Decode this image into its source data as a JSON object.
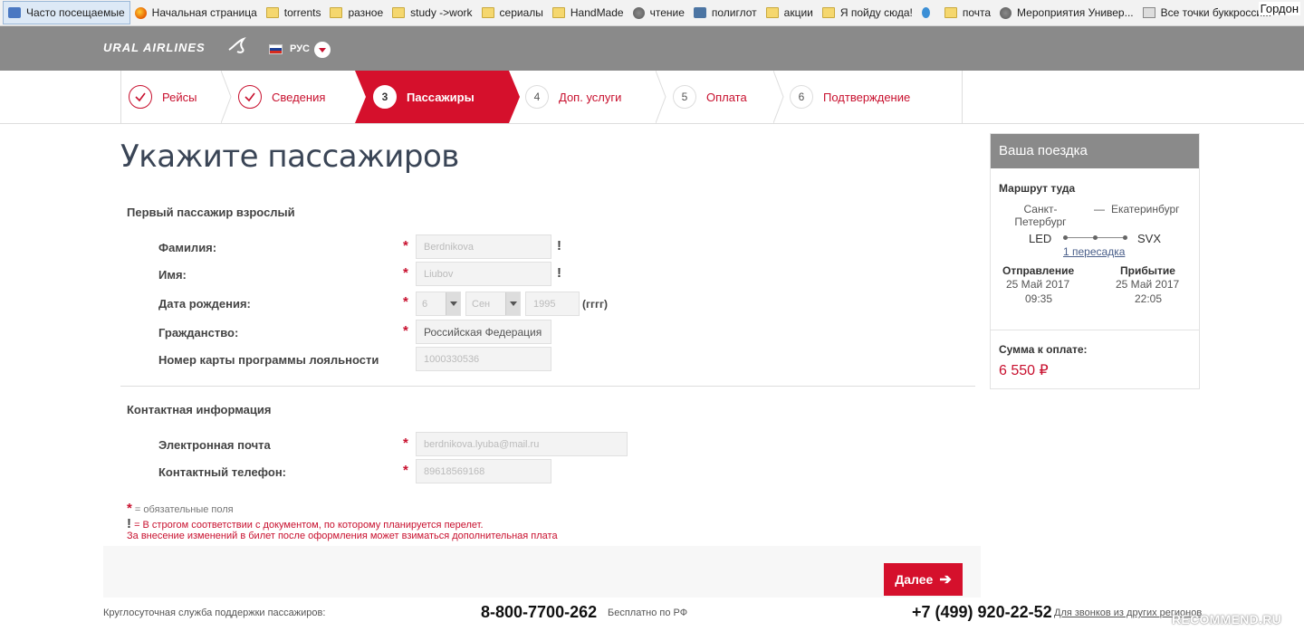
{
  "browser": {
    "bookmarks": [
      {
        "label": "Часто посещаемые",
        "icon": "page-icon"
      },
      {
        "label": "Начальная страница",
        "icon": "firefox-icon"
      },
      {
        "label": "torrents",
        "icon": "folder-icon"
      },
      {
        "label": "разное",
        "icon": "folder-icon"
      },
      {
        "label": "study ->work",
        "icon": "folder-icon"
      },
      {
        "label": "сериалы",
        "icon": "folder-icon"
      },
      {
        "label": "HandMade",
        "icon": "folder-icon"
      },
      {
        "label": "чтение",
        "icon": "globe-icon"
      },
      {
        "label": "полиглот",
        "icon": "vk-icon"
      },
      {
        "label": "акции",
        "icon": "folder-icon"
      },
      {
        "label": "Я пойду сюда!",
        "icon": "folder-icon"
      },
      {
        "label": "почта",
        "icon": "folder-icon"
      },
      {
        "label": "Мероприятия Универ...",
        "icon": "globe-icon"
      },
      {
        "label": "Все точки буккросси...",
        "icon": "image-icon"
      }
    ],
    "corner_text": "Гордон"
  },
  "header": {
    "logo": "URAL AIRLINES",
    "language": "РУС",
    "colors": {
      "brand_red": "#d5102c",
      "header_gray": "#8a8a8a"
    }
  },
  "steps": [
    {
      "number": "1",
      "label": "Рейсы",
      "state": "done"
    },
    {
      "number": "2",
      "label": "Сведения",
      "state": "done"
    },
    {
      "number": "3",
      "label": "Пассажиры",
      "state": "active"
    },
    {
      "number": "4",
      "label": "Доп. услуги",
      "state": "pending"
    },
    {
      "number": "5",
      "label": "Оплата",
      "state": "pending"
    },
    {
      "number": "6",
      "label": "Подтверждение",
      "state": "pending"
    }
  ],
  "form": {
    "title": "Укажите пассажиров",
    "passenger_section": "Первый пассажир взрослый",
    "surname_label": "Фамилия:",
    "surname_value": "Berdnikova",
    "name_label": "Имя:",
    "name_value": "Liubov",
    "dob_label": "Дата рождения:",
    "dob_day": "6",
    "dob_month": "Сен",
    "dob_year": "1995",
    "year_hint": "(гггг)",
    "citizenship_label": "Гражданство:",
    "citizenship_value": "Российская Федерация",
    "loyalty_label": "Номер карты программы лояльности",
    "loyalty_value": "1000330536",
    "contact_section": "Контактная информация",
    "email_label": "Электронная почта",
    "email_value": "berdnikova.lyuba@mail.ru",
    "phone_label": "Контактный телефон:",
    "phone_value": "89618569168",
    "required_mark": "*",
    "exclaim_mark": "!"
  },
  "notes": {
    "required": "= обязательные поля",
    "exact": "= В строгом соответствии с документом, по которому планируется перелет.",
    "fee": "За внесение изменений в билет после оформления может взиматься дополнительная плата"
  },
  "actions": {
    "next_label": "Далее",
    "next_arrow": "➔"
  },
  "footer": {
    "support": "Круглосуточная служба поддержки пассажиров:",
    "phone_free": "8-800-7700-262",
    "free_note": "Бесплатно по РФ",
    "phone_other": "+7 (499) 920-22-52",
    "other_note": "Для звонков из других регионов"
  },
  "trip": {
    "title": "Ваша поездка",
    "route_label": "Маршрут туда",
    "from_city_line1": "Санкт-",
    "from_city_line2": "Петербург",
    "dash": "—",
    "to_city": "Екатеринбург",
    "from_code": "LED",
    "to_code": "SVX",
    "transfers": "1 пересадка",
    "depart_label": "Отправление",
    "depart_date": "25 Май 2017",
    "depart_time": "09:35",
    "arrive_label": "Прибытие",
    "arrive_date": "25 Май 2017",
    "arrive_time": "22:05",
    "sum_label": "Сумма к оплате:",
    "sum_value": "6 550 ₽"
  },
  "watermark": "RECOMMEND.RU"
}
